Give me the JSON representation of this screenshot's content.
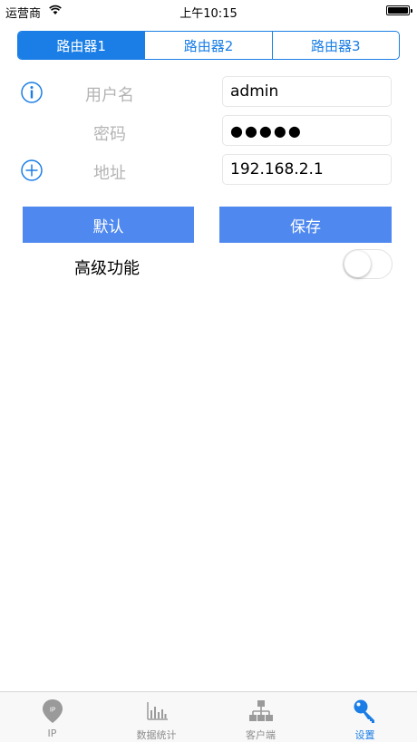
{
  "status_bar": {
    "carrier": "运营商",
    "time": "上午10:15"
  },
  "segments": [
    {
      "label": "路由器1",
      "selected": true
    },
    {
      "label": "路由器2",
      "selected": false
    },
    {
      "label": "路由器3",
      "selected": false
    }
  ],
  "form": {
    "username": {
      "label": "用户名",
      "value": "admin"
    },
    "password": {
      "label": "密码",
      "value": "●●●●●"
    },
    "address": {
      "label": "地址",
      "value": "192.168.2.1"
    }
  },
  "buttons": {
    "default_label": "默认",
    "save_label": "保存"
  },
  "advanced": {
    "label": "高级功能",
    "enabled": false
  },
  "tabbar": [
    {
      "label": "IP",
      "icon": "pin-icon",
      "badge": "IP",
      "active": false
    },
    {
      "label": "数据统计",
      "icon": "bar-chart-icon",
      "active": false
    },
    {
      "label": "客户端",
      "icon": "network-icon",
      "active": false
    },
    {
      "label": "设置",
      "icon": "key-icon",
      "active": true
    }
  ],
  "colors": {
    "accent": "#1a7ee6",
    "button": "#4f88ef",
    "label_gray": "#b4b4b4",
    "tab_inactive": "#8e8e8e"
  }
}
